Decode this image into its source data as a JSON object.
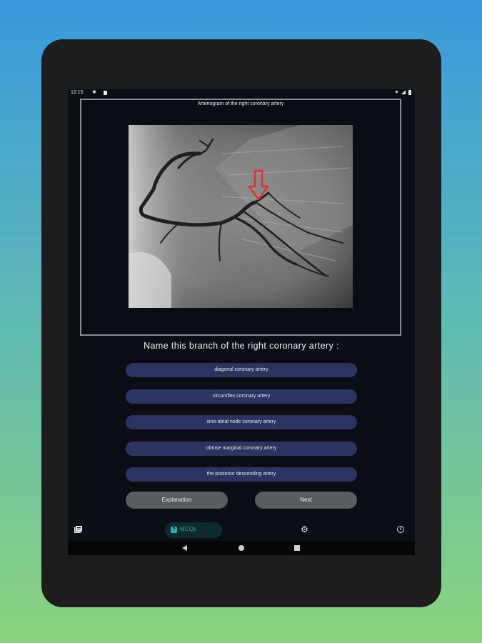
{
  "status": {
    "time": "12:15",
    "icons": [
      "gear-icon",
      "notification-square-icon",
      "wifi-icon",
      "signal-icon",
      "battery-icon"
    ]
  },
  "image_card": {
    "title": "Arteriogram of the right coronary artery",
    "arrow_color": "#e03030"
  },
  "question": "Name this branch of  the right coronary artery  :",
  "options": [
    {
      "label": "diagonal  coronary artery"
    },
    {
      "label": "circumflex coronary artery"
    },
    {
      "label": "sino-atrial node coronary artery"
    },
    {
      "label": "obtuse marginal coronary artery"
    },
    {
      "label": "the posterior descending artery"
    }
  ],
  "buttons": {
    "explanation": "Explanation",
    "next": "Next"
  },
  "bottom_nav": {
    "items": [
      {
        "icon": "library-icon"
      },
      {
        "icon": "quiz-icon",
        "icon_text": "?",
        "label": "MCQs",
        "selected": true
      },
      {
        "icon": "gear-icon"
      },
      {
        "icon": "info-icon",
        "icon_text": "i"
      }
    ]
  },
  "system_nav": {
    "icons": [
      "back-icon",
      "home-icon",
      "recents-icon"
    ]
  },
  "colors": {
    "option_bg": "#2e3461",
    "button_bg": "#5a5c60",
    "accent": "#27a6a6",
    "screen_bg": "#0c0e15"
  }
}
